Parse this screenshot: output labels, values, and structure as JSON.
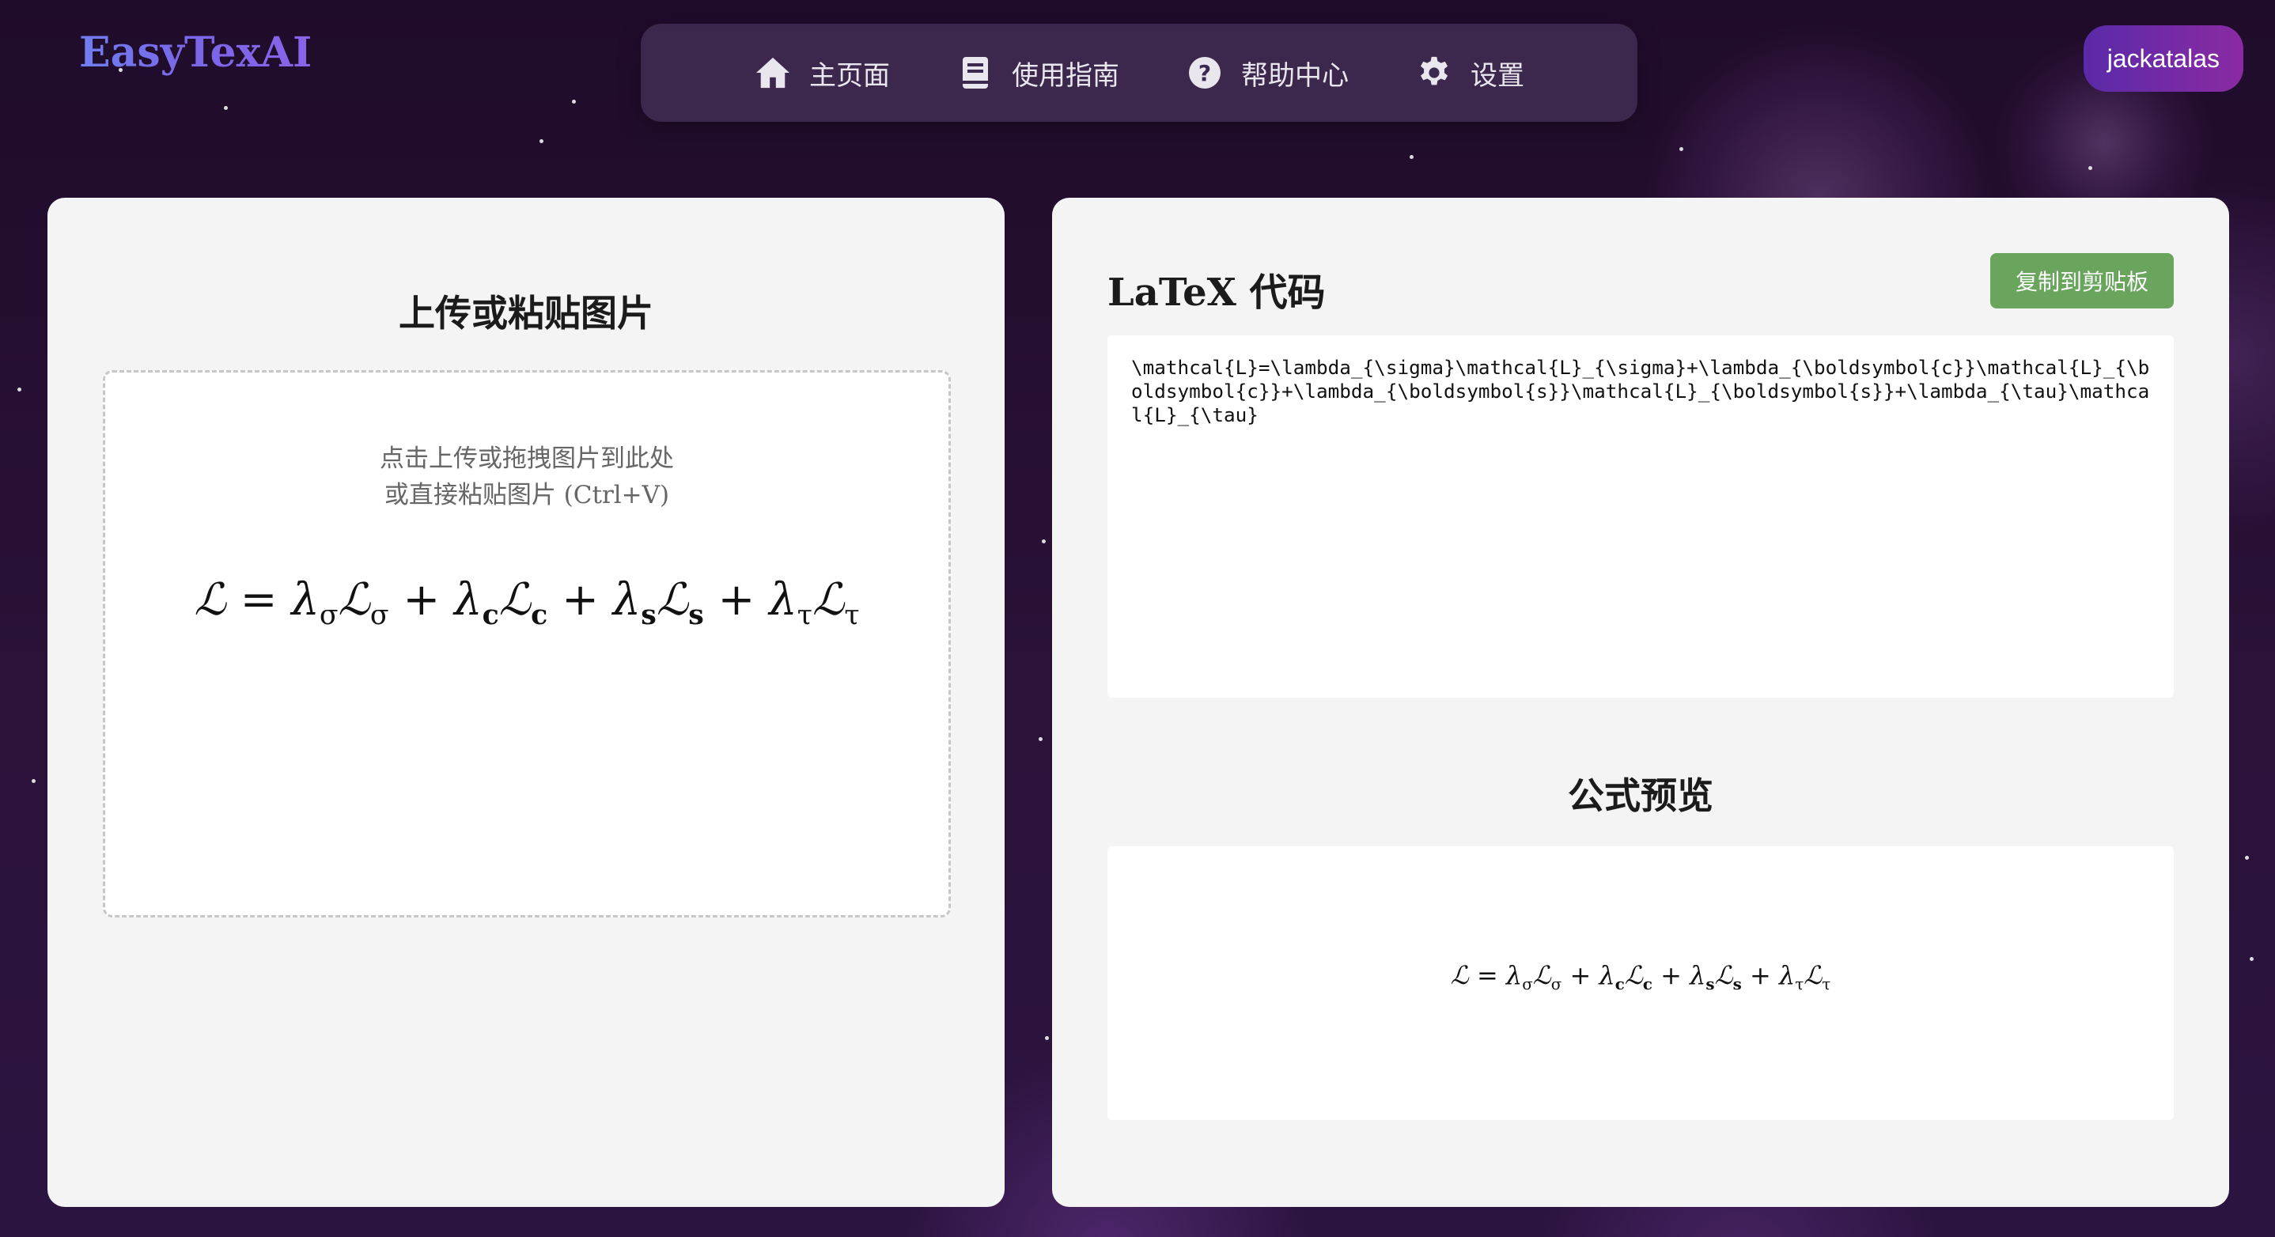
{
  "brand": "EasyTexAI",
  "nav": {
    "items": [
      {
        "label": "主页面",
        "icon": "home-icon"
      },
      {
        "label": "使用指南",
        "icon": "book-icon"
      },
      {
        "label": "帮助中心",
        "icon": "help-icon"
      },
      {
        "label": "设置",
        "icon": "gear-icon"
      }
    ]
  },
  "user": {
    "name": "jackatalas"
  },
  "upload": {
    "title": "上传或粘贴图片",
    "hint_line1": "点击上传或拖拽图片到此处",
    "hint_line2": "或直接粘贴图片 (Ctrl+V)"
  },
  "latex": {
    "title": "LaTeX 代码",
    "copy_label": "复制到剪贴板",
    "code": "\\mathcal{L}=\\lambda_{\\sigma}\\mathcal{L}_{\\sigma}+\\lambda_{\\boldsymbol{c}}\\mathcal{L}_{\\boldsymbol{c}}+\\lambda_{\\boldsymbol{s}}\\mathcal{L}_{\\boldsymbol{s}}+\\lambda_{\\tau}\\mathcal{L}_{\\tau}"
  },
  "preview": {
    "title": "公式预览"
  },
  "formula": {
    "L": "ℒ",
    "eq": "=",
    "plus": "+",
    "lambda": "λ",
    "terms": [
      {
        "sub": "σ"
      },
      {
        "sub": "c"
      },
      {
        "sub": "s"
      },
      {
        "sub": "τ"
      }
    ]
  },
  "colors": {
    "background": "#23102f",
    "copy_button": "#6aa55e",
    "brand_gradient_start": "#6f7ef0",
    "brand_gradient_end": "#8a63e8"
  }
}
